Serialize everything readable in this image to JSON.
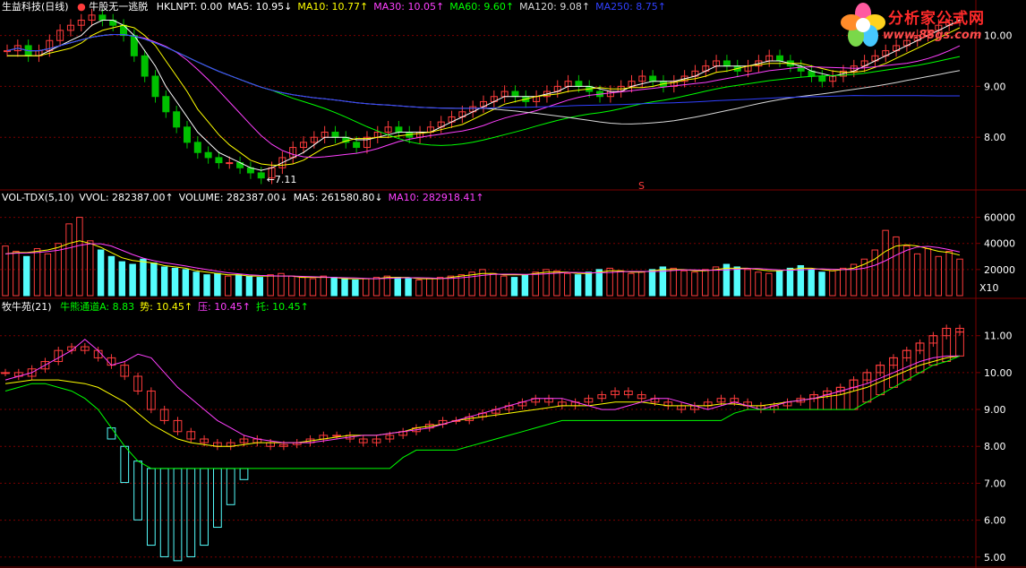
{
  "colors": {
    "up": "#ff3c3c",
    "down": "#54fcfc",
    "green_candle": "#00c000",
    "ma5": "#ffffff",
    "ma10": "#ffff00",
    "ma30": "#ff40ff",
    "ma60": "#00ff00",
    "ma120": "#d8d8d8",
    "ma250": "#3040ff",
    "grid": "#7a0000",
    "axis": "#ffffff"
  },
  "price_panel": {
    "title": "生益科技(日线)",
    "formula": "牛股无一逃脱",
    "indicators": [
      {
        "label": "HKLNPT: 0.00",
        "color": "#ffffff",
        "arrow": ""
      },
      {
        "label": "MA5: 10.95",
        "color": "#ffffff",
        "arrow": "↓"
      },
      {
        "label": "MA10: 10.77",
        "color": "#ffff00",
        "arrow": "↑"
      },
      {
        "label": "MA30: 10.05",
        "color": "#ff40ff",
        "arrow": "↑"
      },
      {
        "label": "MA60: 9.60",
        "color": "#00ff00",
        "arrow": "↑"
      },
      {
        "label": "MA120: 9.08",
        "color": "#d8d8d8",
        "arrow": "↑"
      },
      {
        "label": "MA250: 8.75",
        "color": "#3040ff",
        "arrow": "↑"
      }
    ],
    "low_label": "←7.11",
    "s_marker": "S"
  },
  "volume_panel": {
    "title": "VOL-TDX(5,10)",
    "indicators": [
      {
        "label": "VVOL: 282387.00",
        "color": "#ffffff",
        "arrow": "↑"
      },
      {
        "label": "VOLUME: 282387.00",
        "color": "#ffffff",
        "arrow": "↓"
      },
      {
        "label": "MA5: 261580.80",
        "color": "#ffffff",
        "arrow": "↓"
      },
      {
        "label": "MA10: 282918.41",
        "color": "#ff40ff",
        "arrow": "↑"
      }
    ],
    "unit_label": "X10"
  },
  "lower_panel": {
    "title": "牧牛苑(21)",
    "indicators": [
      {
        "label": "牛熊通道A: 8.83",
        "color": "#00ff00",
        "arrow": ""
      },
      {
        "label": "势: 10.45",
        "color": "#ffff00",
        "arrow": "↑"
      },
      {
        "label": "压: 10.45",
        "color": "#ff40ff",
        "arrow": "↑"
      },
      {
        "label": "托: 10.45",
        "color": "#00ff00",
        "arrow": "↑"
      }
    ]
  },
  "logo": {
    "text": "分析家公式网",
    "url": "www.88gs.com"
  },
  "chart_data": [
    {
      "type": "line",
      "name": "price",
      "ylim": [
        7.0,
        10.45
      ],
      "yticks": [
        8.0,
        9.0,
        10.0
      ],
      "close": [
        9.7,
        9.8,
        9.6,
        9.7,
        9.9,
        10.1,
        10.2,
        10.3,
        10.4,
        10.3,
        10.2,
        10.0,
        9.6,
        9.2,
        8.8,
        8.5,
        8.2,
        7.9,
        7.7,
        7.6,
        7.5,
        7.5,
        7.4,
        7.3,
        7.2,
        7.4,
        7.6,
        7.8,
        7.9,
        8.0,
        8.1,
        8.0,
        7.9,
        7.8,
        8.0,
        8.1,
        8.2,
        8.1,
        8.0,
        8.1,
        8.2,
        8.3,
        8.4,
        8.5,
        8.6,
        8.7,
        8.8,
        8.9,
        8.8,
        8.7,
        8.8,
        8.9,
        9.0,
        9.1,
        9.0,
        8.9,
        8.8,
        8.9,
        9.0,
        9.1,
        9.2,
        9.1,
        9.0,
        9.1,
        9.2,
        9.3,
        9.4,
        9.5,
        9.4,
        9.3,
        9.4,
        9.5,
        9.6,
        9.5,
        9.4,
        9.3,
        9.2,
        9.1,
        9.2,
        9.3,
        9.4,
        9.5,
        9.6,
        9.7,
        9.8,
        9.9,
        10.0,
        10.1,
        10.2,
        10.3,
        10.35
      ],
      "ma5": [
        9.6,
        9.6,
        9.6,
        9.6,
        9.7,
        9.8,
        9.9,
        10.0,
        10.2,
        10.3,
        10.3,
        10.2,
        10.0,
        9.7,
        9.4,
        9.0,
        8.7,
        8.4,
        8.1,
        7.9,
        7.7,
        7.6,
        7.5,
        7.4,
        7.35,
        7.4,
        7.5,
        7.6,
        7.7,
        7.85,
        8.0,
        8.0,
        8.0,
        7.95,
        7.95,
        8.0,
        8.05,
        8.1,
        8.1,
        8.1,
        8.1,
        8.2,
        8.3,
        8.4,
        8.5,
        8.6,
        8.7,
        8.8,
        8.8,
        8.8,
        8.8,
        8.85,
        8.9,
        9.0,
        9.0,
        9.0,
        8.95,
        8.9,
        8.9,
        9.0,
        9.05,
        9.1,
        9.1,
        9.1,
        9.15,
        9.2,
        9.3,
        9.4,
        9.4,
        9.4,
        9.4,
        9.45,
        9.5,
        9.5,
        9.45,
        9.4,
        9.3,
        9.25,
        9.2,
        9.25,
        9.3,
        9.4,
        9.5,
        9.6,
        9.7,
        9.8,
        9.9,
        10.0,
        10.1,
        10.2,
        10.3
      ]
    },
    {
      "type": "bar",
      "name": "volume",
      "ylim": [
        0,
        70000
      ],
      "yticks": [
        20000,
        40000,
        60000
      ],
      "values": [
        38000,
        34000,
        30000,
        36000,
        32000,
        40000,
        55000,
        60000,
        42000,
        35000,
        30000,
        26000,
        24000,
        28000,
        25000,
        22000,
        21000,
        20000,
        18000,
        16000,
        17000,
        15000,
        16000,
        15000,
        14000,
        16000,
        17000,
        15000,
        14000,
        13000,
        15000,
        14000,
        13000,
        12000,
        13000,
        14000,
        15000,
        14000,
        13000,
        12000,
        13000,
        14000,
        15000,
        16000,
        18000,
        20000,
        17000,
        15000,
        14000,
        16000,
        18000,
        20000,
        19000,
        17000,
        16000,
        18000,
        20000,
        21000,
        19000,
        17000,
        18000,
        20000,
        22000,
        21000,
        19000,
        18000,
        20000,
        22000,
        24000,
        22000,
        20000,
        18000,
        17000,
        19000,
        21000,
        23000,
        20000,
        18000,
        19000,
        21000,
        24000,
        28000,
        35000,
        50000,
        45000,
        38000,
        32000,
        36000,
        30000,
        34000,
        28000
      ],
      "ma": [
        32000,
        33000,
        33000,
        34000,
        35000,
        37000,
        40000,
        42000,
        40000,
        37000,
        33000,
        29000,
        27000,
        26000,
        25000,
        23000,
        22000,
        21000,
        19000,
        18000,
        17000,
        16000,
        16000,
        15000,
        15000,
        15000,
        15000,
        15000,
        14000,
        14000,
        14000,
        14000,
        13000,
        13000,
        13000,
        13000,
        14000,
        14000,
        14000,
        13000,
        13000,
        13000,
        14000,
        15000,
        16000,
        17000,
        17000,
        16000,
        16000,
        16000,
        17000,
        18000,
        18000,
        18000,
        17000,
        17000,
        18000,
        19000,
        19000,
        18000,
        18000,
        19000,
        20000,
        20000,
        20000,
        19000,
        19000,
        20000,
        21000,
        21000,
        21000,
        20000,
        19000,
        19000,
        20000,
        21000,
        21000,
        20000,
        19000,
        20000,
        21000,
        24000,
        28000,
        34000,
        38000,
        39000,
        38000,
        36000,
        34000,
        33000,
        31000
      ]
    },
    {
      "type": "line",
      "name": "lower",
      "ylim": [
        4.8,
        11.6
      ],
      "yticks": [
        5.0,
        6.0,
        7.0,
        8.0,
        9.0,
        10.0,
        11.0
      ],
      "price": [
        10.0,
        9.9,
        10.1,
        10.3,
        10.6,
        10.7,
        10.6,
        10.4,
        10.2,
        9.9,
        9.5,
        9.0,
        8.7,
        8.4,
        8.2,
        8.1,
        8.0,
        8.1,
        8.2,
        8.1,
        8.0,
        8.05,
        8.1,
        8.2,
        8.3,
        8.3,
        8.2,
        8.1,
        8.2,
        8.3,
        8.4,
        8.5,
        8.6,
        8.7,
        8.7,
        8.8,
        8.9,
        9.0,
        9.1,
        9.2,
        9.3,
        9.2,
        9.1,
        9.2,
        9.3,
        9.4,
        9.5,
        9.4,
        9.3,
        9.2,
        9.1,
        9.0,
        9.1,
        9.2,
        9.3,
        9.2,
        9.1,
        9.0,
        9.1,
        9.2,
        9.3,
        9.4,
        9.5,
        9.6,
        9.8,
        10.0,
        10.2,
        10.4,
        10.6,
        10.8,
        11.0,
        11.2,
        11.1
      ],
      "trend": [
        9.7,
        9.75,
        9.8,
        9.8,
        9.8,
        9.75,
        9.7,
        9.6,
        9.4,
        9.2,
        8.9,
        8.6,
        8.4,
        8.2,
        8.1,
        8.05,
        8.0,
        8.0,
        8.05,
        8.1,
        8.1,
        8.1,
        8.1,
        8.15,
        8.2,
        8.25,
        8.3,
        8.3,
        8.3,
        8.35,
        8.4,
        8.5,
        8.55,
        8.6,
        8.7,
        8.75,
        8.8,
        8.85,
        8.9,
        8.95,
        9.0,
        9.05,
        9.1,
        9.1,
        9.1,
        9.15,
        9.2,
        9.2,
        9.2,
        9.15,
        9.1,
        9.1,
        9.1,
        9.1,
        9.15,
        9.15,
        9.1,
        9.1,
        9.15,
        9.2,
        9.25,
        9.3,
        9.35,
        9.4,
        9.5,
        9.6,
        9.75,
        9.9,
        10.05,
        10.2,
        10.3,
        10.4,
        10.45
      ],
      "pressure": [
        9.8,
        9.9,
        10.0,
        10.2,
        10.4,
        10.6,
        10.9,
        10.6,
        10.2,
        10.3,
        10.5,
        10.4,
        10.0,
        9.6,
        9.3,
        9.0,
        8.7,
        8.5,
        8.3,
        8.2,
        8.15,
        8.1,
        8.1,
        8.1,
        8.15,
        8.2,
        8.25,
        8.3,
        8.3,
        8.35,
        8.4,
        8.45,
        8.5,
        8.6,
        8.7,
        8.8,
        8.9,
        9.0,
        9.1,
        9.2,
        9.3,
        9.3,
        9.3,
        9.2,
        9.1,
        9.0,
        9.0,
        9.1,
        9.2,
        9.3,
        9.3,
        9.2,
        9.1,
        9.0,
        9.1,
        9.2,
        9.1,
        9.0,
        9.1,
        9.2,
        9.25,
        9.3,
        9.4,
        9.5,
        9.6,
        9.7,
        9.85,
        10.0,
        10.15,
        10.3,
        10.4,
        10.45,
        10.45
      ],
      "support": [
        9.5,
        9.6,
        9.7,
        9.7,
        9.6,
        9.5,
        9.3,
        9.0,
        8.5,
        8.0,
        7.6,
        7.4,
        7.4,
        7.4,
        7.4,
        7.4,
        7.4,
        7.4,
        7.4,
        7.4,
        7.4,
        7.4,
        7.4,
        7.4,
        7.4,
        7.4,
        7.4,
        7.4,
        7.4,
        7.4,
        7.7,
        7.9,
        7.9,
        7.9,
        7.9,
        8.0,
        8.1,
        8.2,
        8.3,
        8.4,
        8.5,
        8.6,
        8.7,
        8.7,
        8.7,
        8.7,
        8.7,
        8.7,
        8.7,
        8.7,
        8.7,
        8.7,
        8.7,
        8.7,
        8.7,
        8.9,
        9.0,
        9.0,
        9.0,
        9.0,
        9.0,
        9.0,
        9.0,
        9.0,
        9.0,
        9.2,
        9.4,
        9.6,
        9.8,
        10.0,
        10.2,
        10.3,
        10.45
      ]
    }
  ]
}
